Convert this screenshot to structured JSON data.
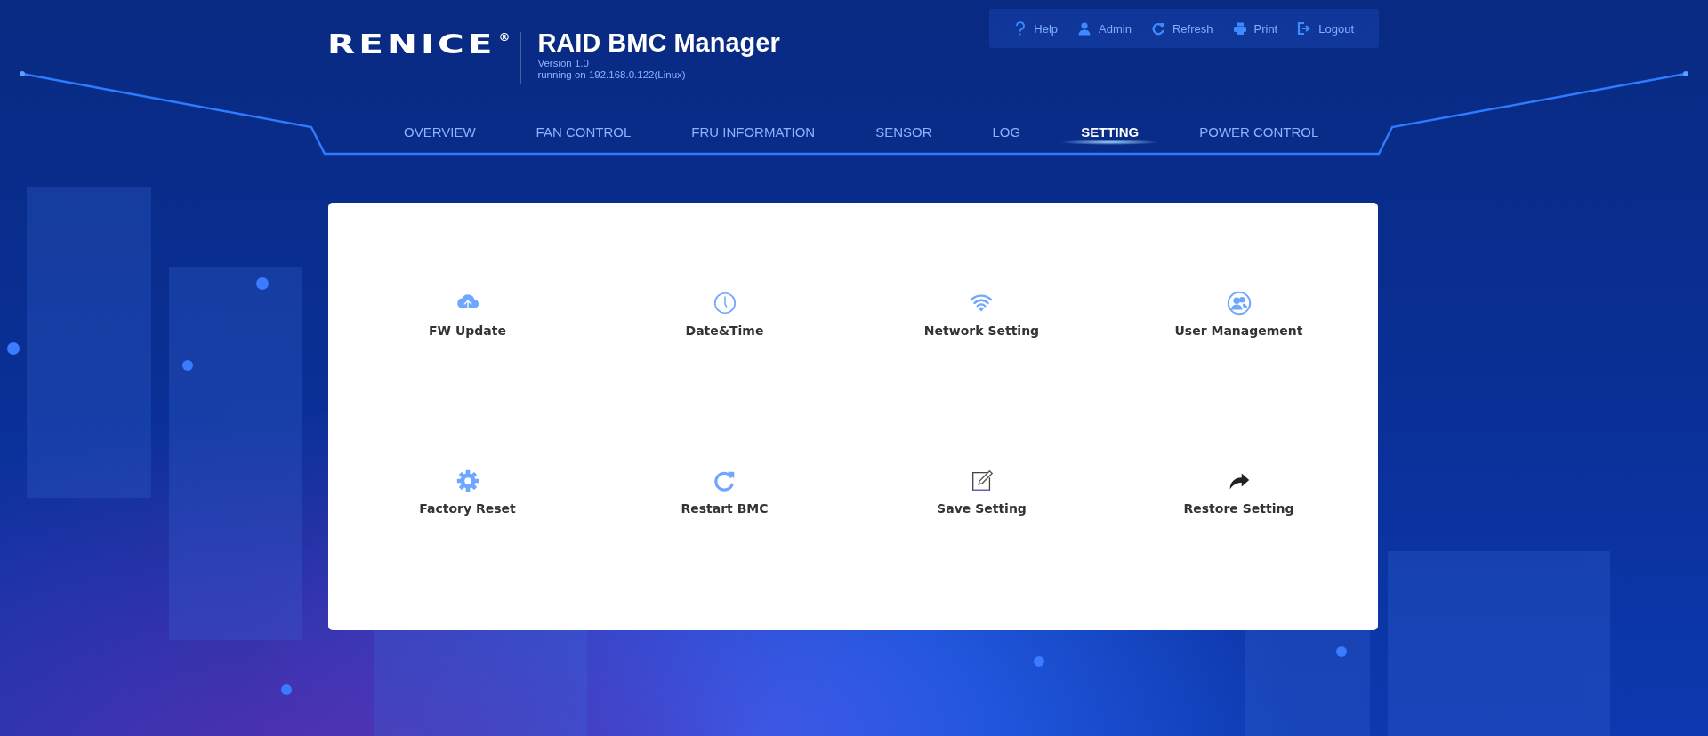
{
  "header": {
    "logo": "RENICE",
    "logo_mark": "®",
    "title": "RAID BMC Manager",
    "version": "Version 1.0",
    "host": "running on 192.168.0.122(Linux)"
  },
  "toolbar": [
    {
      "kind": "help",
      "label": "Help"
    },
    {
      "kind": "user",
      "label": "Admin"
    },
    {
      "kind": "refresh",
      "label": "Refresh"
    },
    {
      "kind": "print",
      "label": "Print"
    },
    {
      "kind": "logout",
      "label": "Logout"
    }
  ],
  "nav": [
    {
      "label": "OVERVIEW",
      "selected": false
    },
    {
      "label": "FAN CONTROL",
      "selected": false
    },
    {
      "label": "FRU INFORMATION",
      "selected": false
    },
    {
      "label": "SENSOR",
      "selected": false
    },
    {
      "label": "LOG",
      "selected": false
    },
    {
      "label": "SETTING",
      "selected": true
    },
    {
      "label": "POWER CONTROL",
      "selected": false
    }
  ],
  "settings": [
    {
      "kind": "cloud",
      "label": "FW Update"
    },
    {
      "kind": "clock",
      "label": "Date&Time"
    },
    {
      "kind": "wifi",
      "label": "Network Setting"
    },
    {
      "kind": "users",
      "label": "User Management"
    },
    {
      "kind": "gear",
      "label": "Factory Reset"
    },
    {
      "kind": "refresh",
      "label": "Restart BMC"
    },
    {
      "kind": "edit",
      "label": "Save Setting"
    },
    {
      "kind": "share",
      "label": "Restore Setting"
    }
  ]
}
